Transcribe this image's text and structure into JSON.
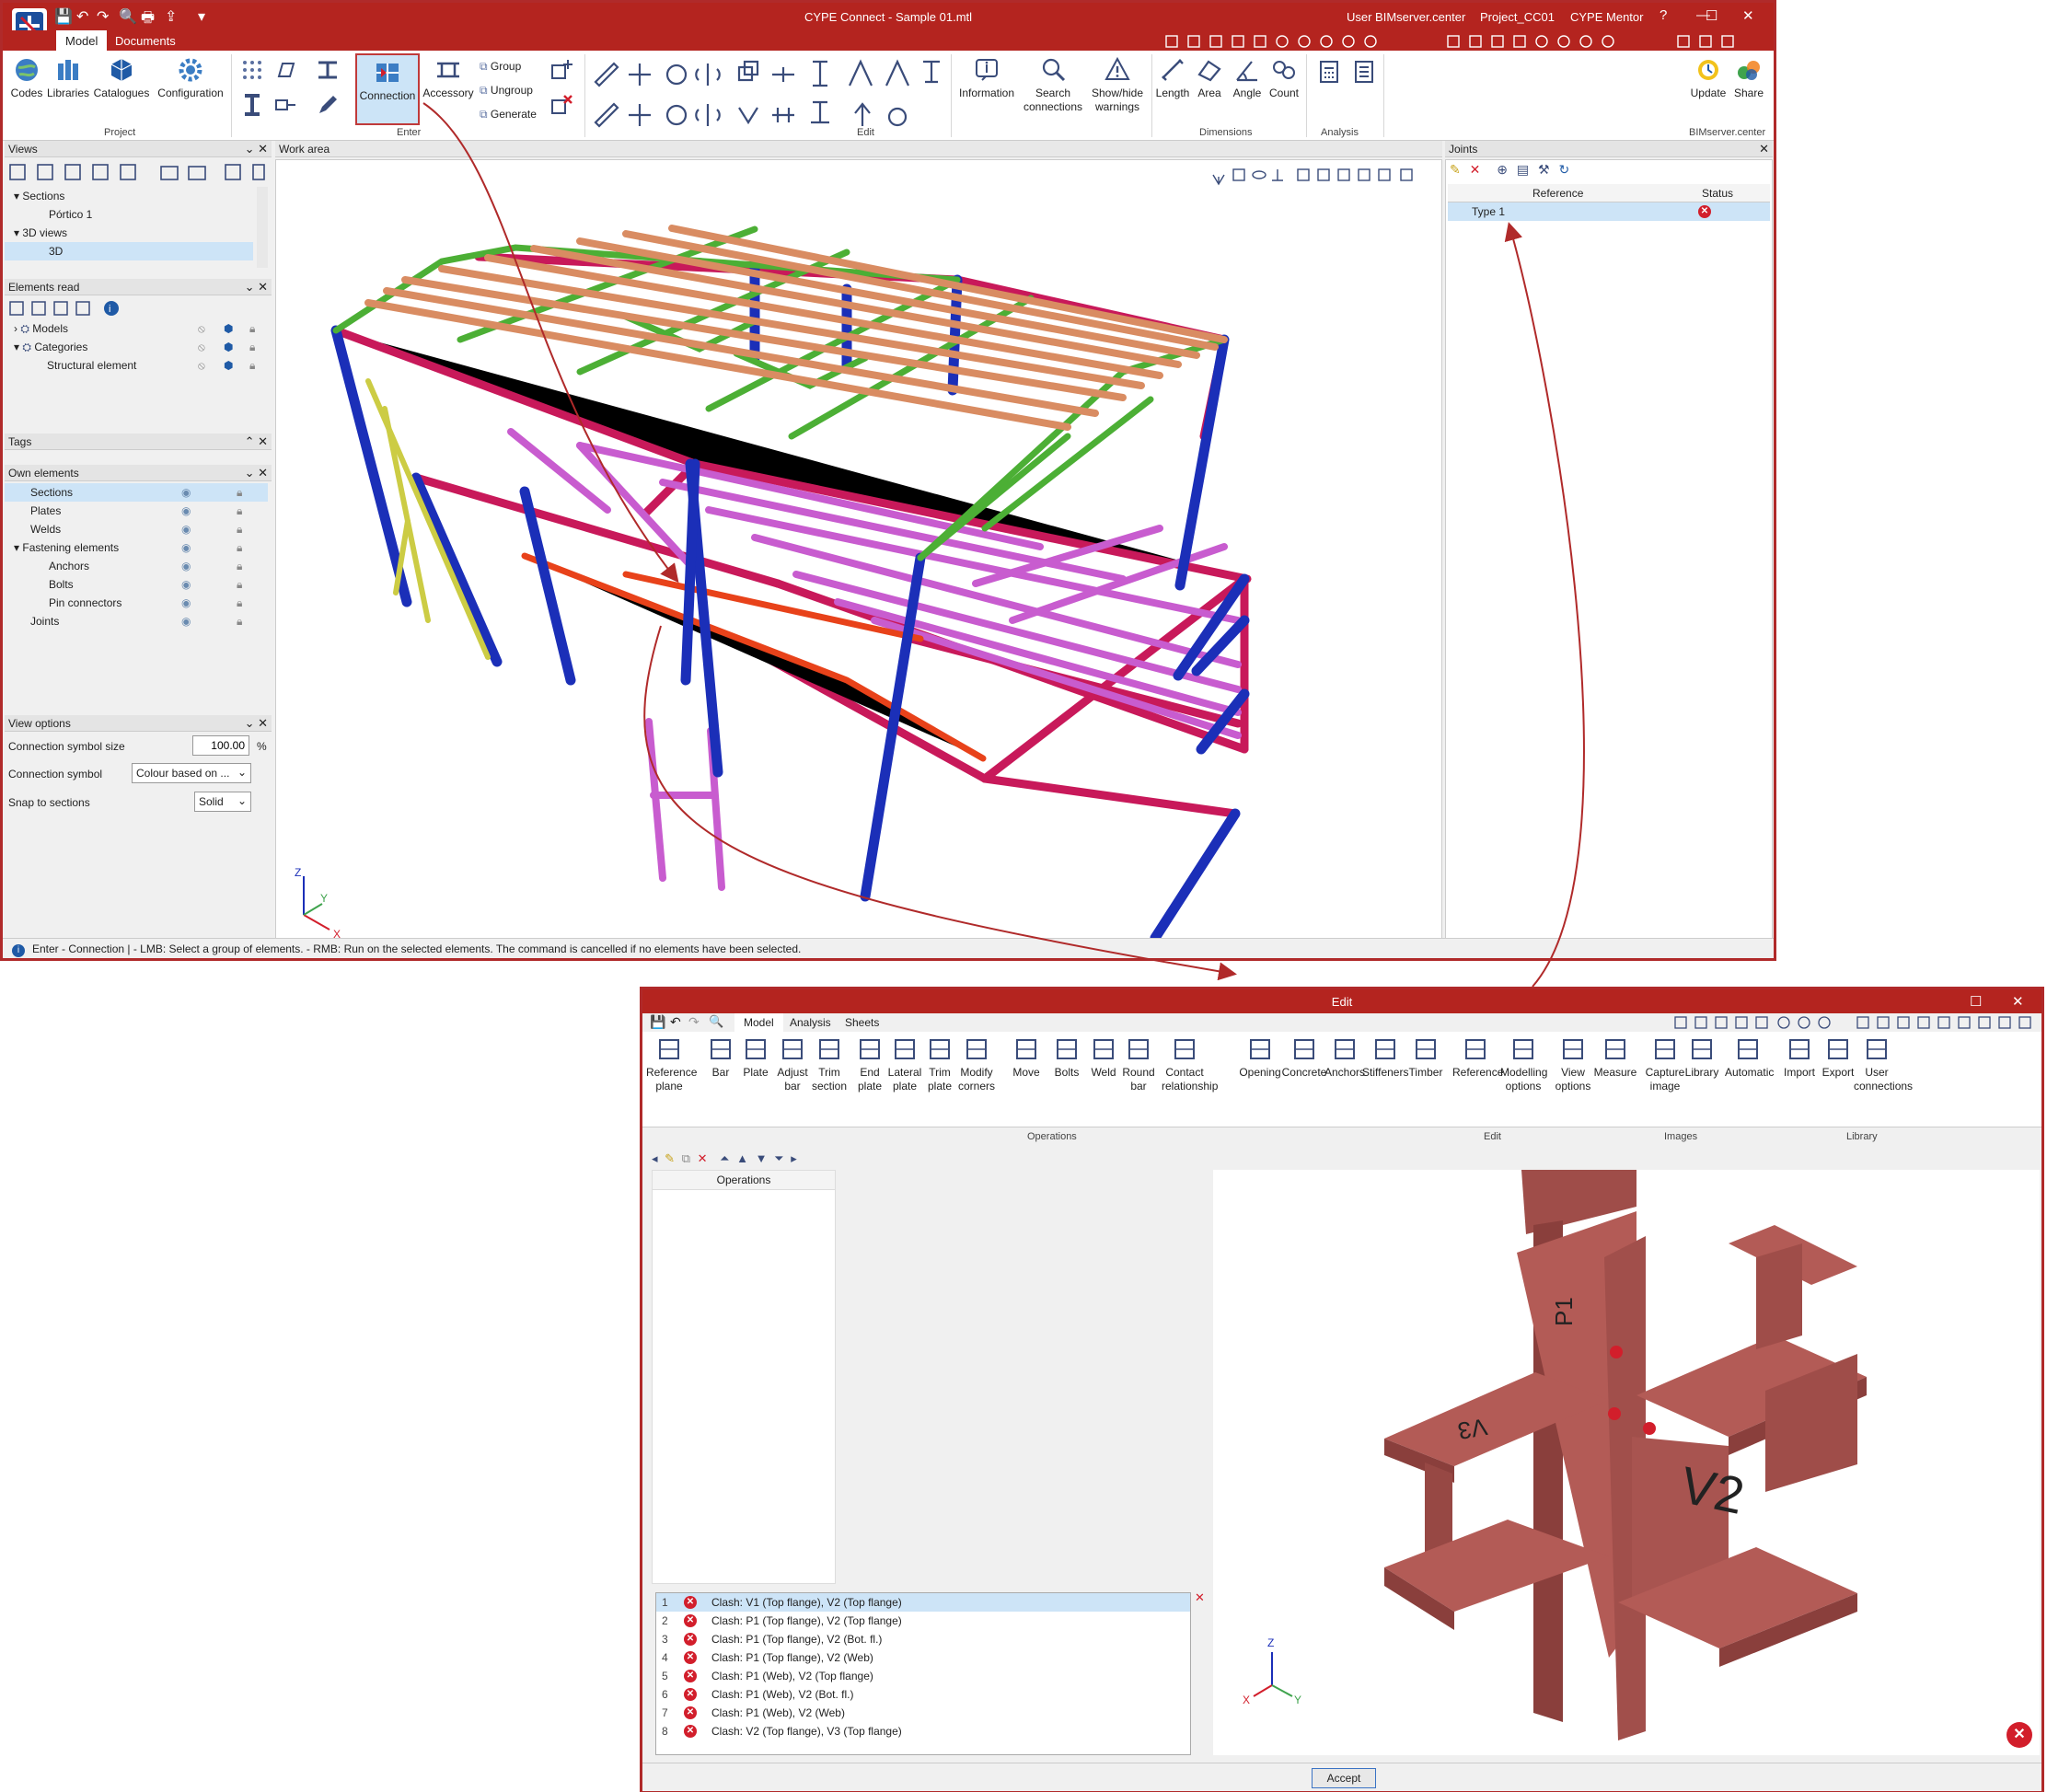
{
  "main": {
    "title": "CYPE Connect - Sample 01.mtl",
    "user": "User BIMserver.center",
    "project": "Project_CC01",
    "mentor": "CYPE Mentor",
    "tabs": [
      "Model",
      "Documents"
    ],
    "ribbon": {
      "codes": "Codes",
      "libraries": "Libraries",
      "catalogues": "Catalogues",
      "configuration": "Configuration",
      "connection": "Connection",
      "accessory": "Accessory",
      "group": "Group",
      "ungroup": "Ungroup",
      "generate": "Generate",
      "information": "Information",
      "search_connections_1": "Search",
      "search_connections_2": "connections",
      "show_hide_1": "Show/hide",
      "show_hide_2": "warnings",
      "length": "Length",
      "area": "Area",
      "angle": "Angle",
      "count": "Count",
      "update": "Update",
      "share": "Share",
      "groups": {
        "project": "Project",
        "enter": "Enter",
        "edit": "Edit",
        "dimensions": "Dimensions",
        "analysis": "Analysis",
        "bimserver": "BIMserver.center"
      }
    },
    "views_panel": {
      "title": "Views",
      "items": [
        "Sections",
        "Pórtico 1",
        "3D views",
        "3D"
      ]
    },
    "elements_panel": {
      "title": "Elements read",
      "items": [
        "Models",
        "Categories",
        "Structural element"
      ]
    },
    "tags_panel": {
      "title": "Tags"
    },
    "own_panel": {
      "title": "Own elements",
      "items": [
        "Sections",
        "Plates",
        "Welds",
        "Fastening elements",
        "Anchors",
        "Bolts",
        "Pin connectors",
        "Joints"
      ]
    },
    "view_options": {
      "title": "View options",
      "symbol_size_label": "Connection symbol size",
      "symbol_size_value": "100.00",
      "symbol_size_unit": "%",
      "symbol_label": "Connection symbol",
      "symbol_value": "Colour based on ...",
      "snap_label": "Snap to sections",
      "snap_value": "Solid"
    },
    "work_area": "Work area",
    "joints_panel": {
      "title": "Joints",
      "col_reference": "Reference",
      "col_status": "Status",
      "rows": [
        {
          "reference": "Type 1"
        }
      ]
    },
    "status_bar": "Enter - Connection  |  - LMB: Select a group of elements. - RMB: Run on the selected elements. The command is cancelled if no elements have been selected.",
    "axes": {
      "x": "X",
      "y": "Y",
      "z": "Z"
    }
  },
  "edit": {
    "title": "Edit",
    "tabs": [
      "Model",
      "Analysis",
      "Sheets"
    ],
    "ribbon": [
      [
        "Reference",
        "plane"
      ],
      [
        "Bar",
        ""
      ],
      [
        "Plate",
        ""
      ],
      [
        "Adjust",
        "bar"
      ],
      [
        "Trim",
        "section"
      ],
      [
        "End",
        "plate"
      ],
      [
        "Lateral",
        "plate"
      ],
      [
        "Trim",
        "plate"
      ],
      [
        "Modify",
        "corners"
      ],
      [
        "Move",
        ""
      ],
      [
        "Bolts",
        ""
      ],
      [
        "Weld",
        ""
      ],
      [
        "Round",
        "bar"
      ],
      [
        "Contact",
        "relationship"
      ],
      [
        "Opening",
        ""
      ],
      [
        "Concrete",
        ""
      ],
      [
        "Anchors",
        ""
      ],
      [
        "Stiffeners",
        ""
      ],
      [
        "Timber",
        ""
      ],
      [
        "Reference",
        ""
      ],
      [
        "Modelling",
        "options"
      ],
      [
        "View",
        "options"
      ],
      [
        "Measure",
        ""
      ],
      [
        "Capture",
        "image"
      ],
      [
        "Library",
        ""
      ],
      [
        "Automatic",
        ""
      ],
      [
        "Import",
        ""
      ],
      [
        "Export",
        ""
      ],
      [
        "User",
        "connections"
      ]
    ],
    "groups": {
      "operations": "Operations",
      "edit": "Edit",
      "images": "Images",
      "library": "Library"
    },
    "operations_header": "Operations",
    "clashes": [
      "Clash: V1 (Top flange), V2 (Top flange)",
      "Clash: P1 (Top flange), V2 (Top flange)",
      "Clash: P1 (Top flange), V2 (Bot. fl.)",
      "Clash: P1 (Top flange), V2 (Web)",
      "Clash: P1 (Web), V2 (Top flange)",
      "Clash: P1 (Web), V2 (Bot. fl.)",
      "Clash: P1 (Web), V2 (Web)",
      "Clash: V2 (Top flange), V3 (Top flange)"
    ],
    "labels": {
      "v2": "V2",
      "v3": "V3",
      "p1": "P1"
    },
    "accept": "Accept",
    "colors": {
      "steel": "#a3514d",
      "accent": "#b4241f",
      "error": "#d21e2b"
    }
  }
}
